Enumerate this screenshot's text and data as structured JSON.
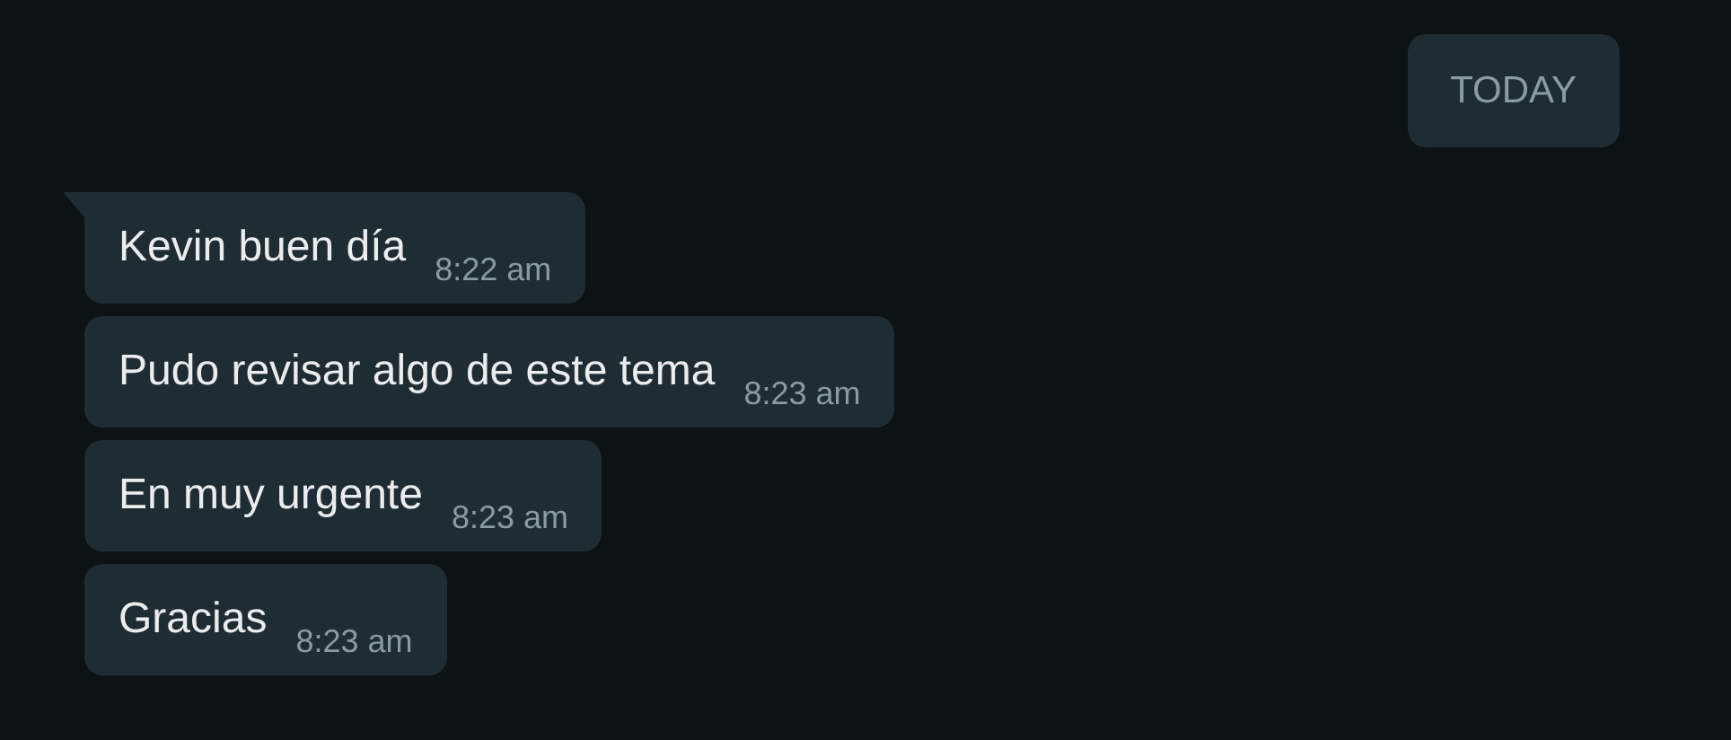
{
  "date_divider": "TODAY",
  "messages": [
    {
      "text": "Kevin buen día",
      "time": "8:22 am",
      "first_in_group": true
    },
    {
      "text": "Pudo revisar algo de este tema",
      "time": "8:23 am",
      "first_in_group": false
    },
    {
      "text": "En muy urgente",
      "time": "8:23 am",
      "first_in_group": false
    },
    {
      "text": "Gracias",
      "time": "8:23 am",
      "first_in_group": false
    }
  ]
}
